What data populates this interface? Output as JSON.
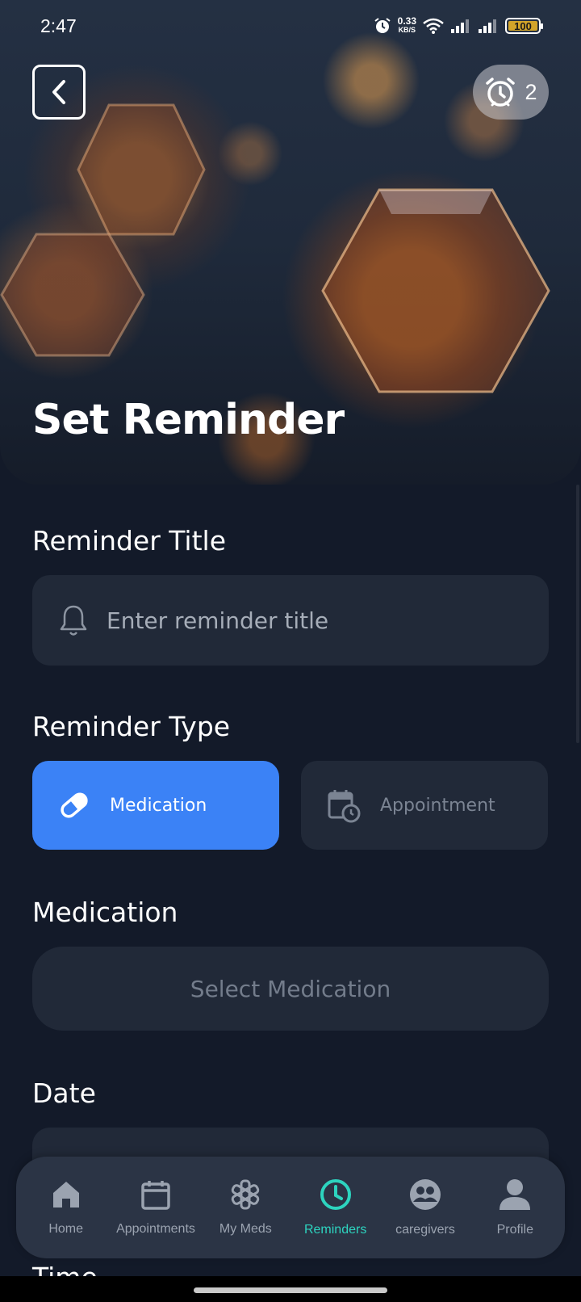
{
  "status_bar": {
    "time": "2:47",
    "net_speed_value": "0.33",
    "net_speed_unit": "KB/S",
    "battery": "100"
  },
  "header": {
    "title": "Set Reminder",
    "alarm_count": "2"
  },
  "form": {
    "title_label": "Reminder Title",
    "title_placeholder": "Enter reminder title",
    "type_label": "Reminder Type",
    "type_options": [
      "Medication",
      "Appointment"
    ],
    "selected_type": "Medication",
    "medication_label": "Medication",
    "medication_placeholder": "Select Medication",
    "date_label": "Date",
    "time_label": "Time"
  },
  "nav": {
    "items": [
      "Home",
      "Appointments",
      "My Meds",
      "Reminders",
      "caregivers",
      "Profile"
    ],
    "active": "Reminders"
  },
  "colors": {
    "background": "#131a29",
    "field": "#212938",
    "accent_blue": "#3b82f6",
    "accent_teal": "#2dd4bf"
  }
}
